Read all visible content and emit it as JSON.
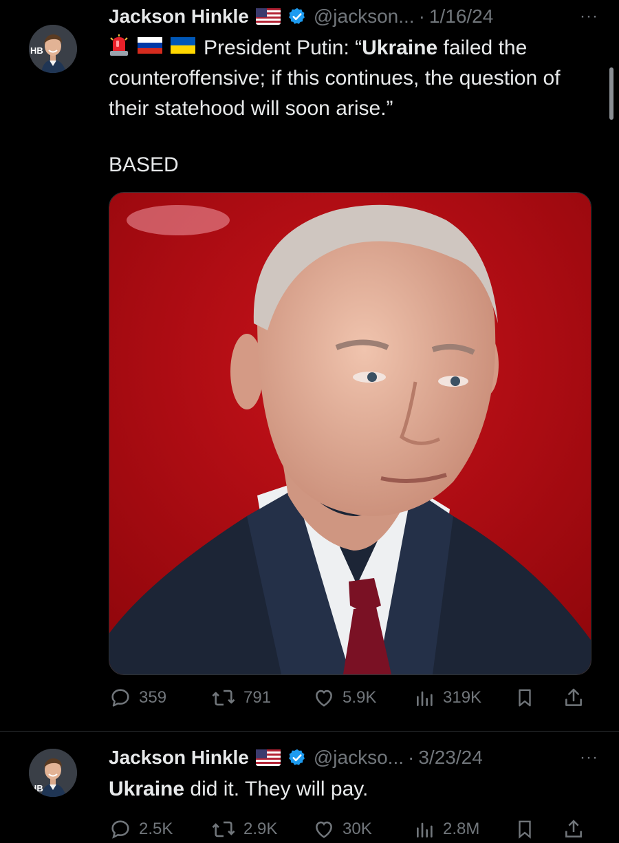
{
  "tweets": [
    {
      "author": "Jackson Hinkle",
      "handle": "@jackson...",
      "date": "1/16/24",
      "more_label": "···",
      "avatar_badge": "HB",
      "line_parts": {
        "intro": "President Putin: “",
        "bold": "Ukraine",
        "rest": " failed the counteroffensive; if this continues, the question of their statehood will soon arise.”"
      },
      "extra_line": "BASED",
      "stats": {
        "replies": "359",
        "reposts": "791",
        "likes": "5.9K",
        "views": "319K"
      }
    },
    {
      "author": "Jackson Hinkle",
      "handle": "@jackso...",
      "date": "3/23/24",
      "more_label": "···",
      "avatar_badge": "HB",
      "line_parts": {
        "bold": "Ukraine",
        "rest": " did it. They will pay."
      },
      "stats": {
        "replies": "2.5K",
        "reposts": "2.9K",
        "likes": "30K",
        "views": "2.8M"
      }
    }
  ],
  "separator": "·",
  "colors": {
    "background": "#000000",
    "text": "#e7e9ea",
    "muted": "#71767b",
    "verified": "#1d9bf0",
    "media_bg": "#b0090f"
  },
  "icons": [
    "reply-icon",
    "repost-icon",
    "like-icon",
    "views-icon",
    "bookmark-icon",
    "share-icon",
    "verified-icon",
    "us-flag-icon",
    "russia-flag-icon",
    "ukraine-flag-icon",
    "siren-icon"
  ]
}
